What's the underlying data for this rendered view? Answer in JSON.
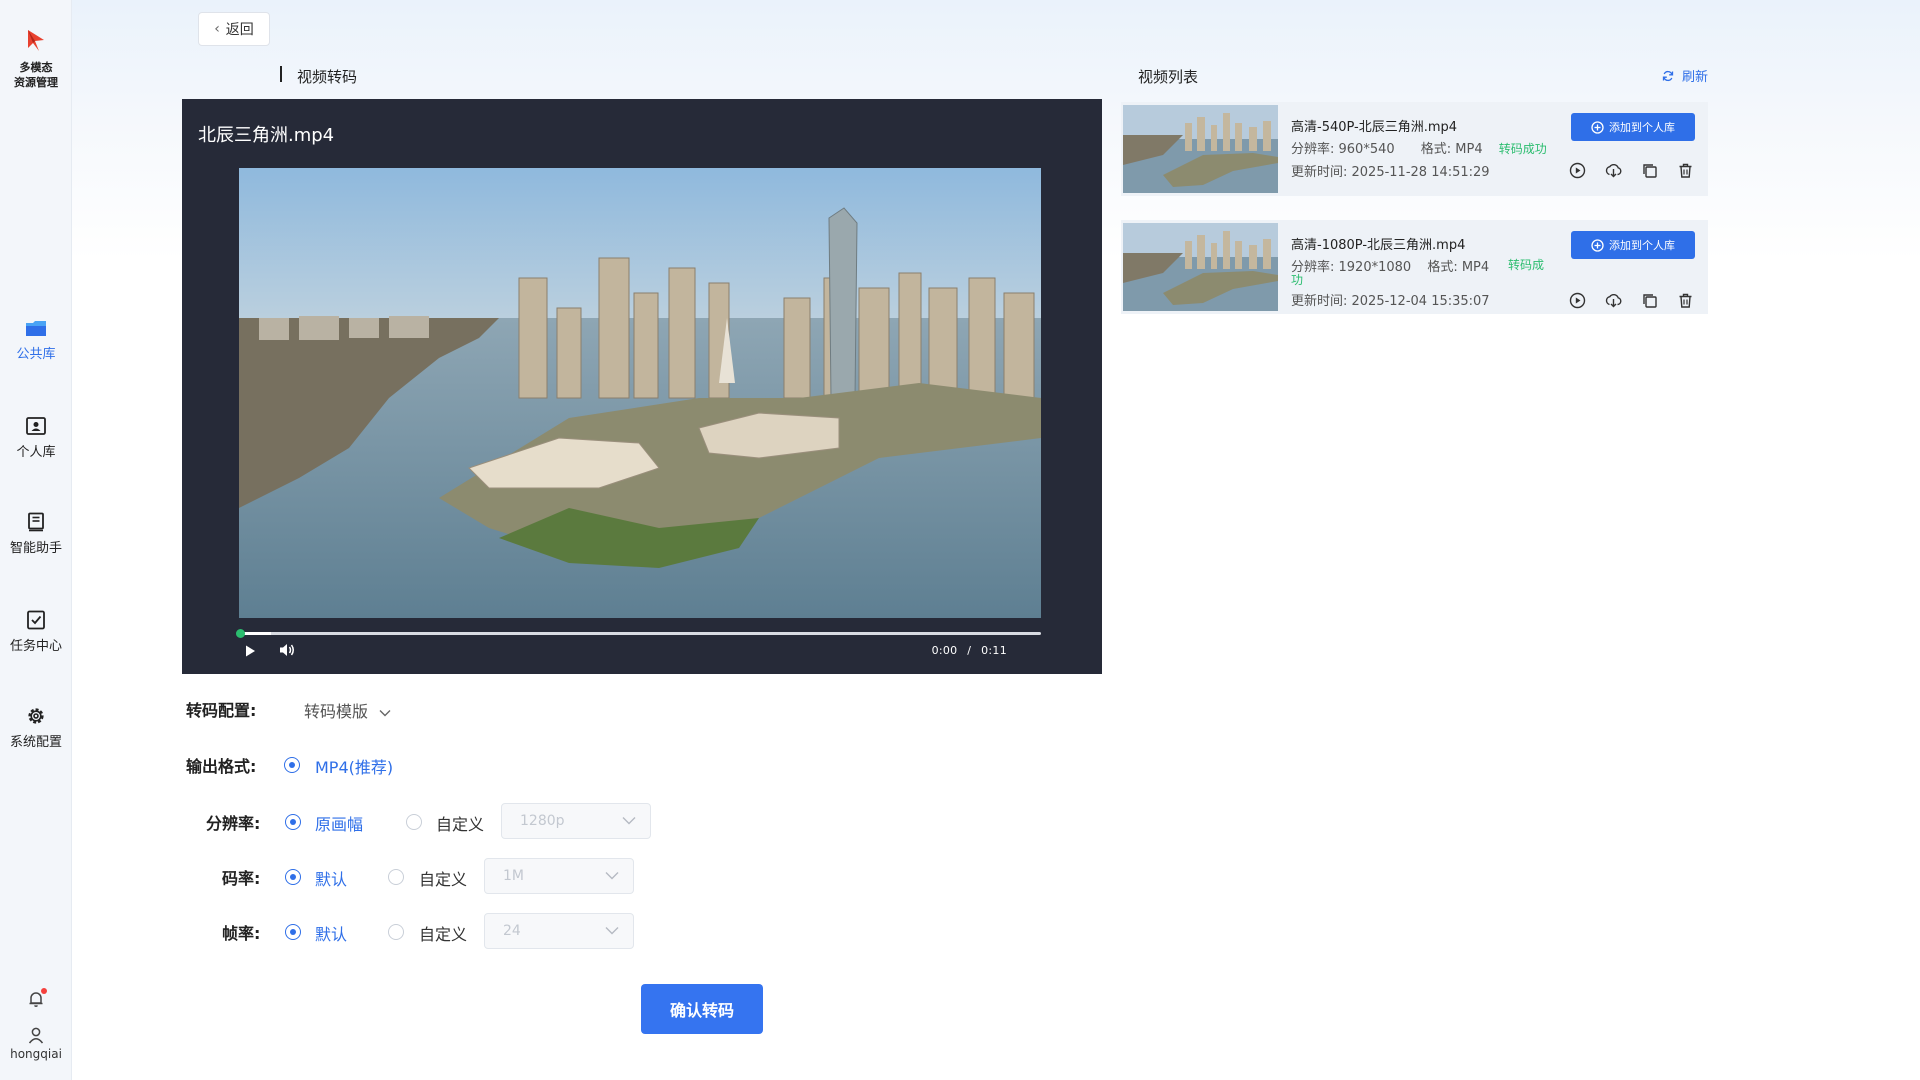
{
  "sidebar": {
    "app_name_line1": "多模态",
    "app_name_line2": "资源管理",
    "items": [
      {
        "label": "公共库",
        "icon": "folder-icon",
        "active": true
      },
      {
        "label": "个人库",
        "icon": "person-card-icon",
        "active": false
      },
      {
        "label": "智能助手",
        "icon": "assistant-book-icon",
        "active": false
      },
      {
        "label": "任务中心",
        "icon": "task-check-icon",
        "active": false
      },
      {
        "label": "系统配置",
        "icon": "gear-icon",
        "active": false
      }
    ],
    "user": "hongqiai",
    "accent": "#2f6fe8"
  },
  "header": {
    "back_label": "返回"
  },
  "player_section": {
    "title": "视频转码",
    "file_name": "北辰三角洲.mp4",
    "time_current": "0:00",
    "time_separator": "/",
    "time_total": "0:11",
    "progress": 0.04
  },
  "form": {
    "config_label": "转码配置:",
    "template_placeholder": "转码模版",
    "format_label": "输出格式:",
    "format_option": "MP4(推荐)",
    "resolution_label": "分辨率:",
    "resolution_default": "原画幅",
    "resolution_custom": "自定义",
    "resolution_select": "1280p",
    "bitrate_label": "码率:",
    "bitrate_default": "默认",
    "bitrate_custom": "自定义",
    "bitrate_select": "1M",
    "framerate_label": "帧率:",
    "framerate_default": "默认",
    "framerate_custom": "自定义",
    "framerate_select": "24",
    "confirm_label": "确认转码"
  },
  "video_list": {
    "title": "视频列表",
    "refresh_label": "刷新",
    "add_label": "添加到个人库",
    "items": [
      {
        "title": "高清-540P-北辰三角洲.mp4",
        "resolution": "分辨率: 960*540",
        "format": "格式: MP4",
        "status": "转码成功",
        "updated": "更新时间: 2025-11-28 14:51:29"
      },
      {
        "title": "高清-1080P-北辰三角洲.mp4",
        "resolution": "分辨率: 1920*1080",
        "format": "格式: MP4",
        "status_line1": "转码成",
        "status_line2": "功",
        "updated": "更新时间: 2025-12-04 15:35:07"
      }
    ],
    "status_color": "#2bbd6f"
  }
}
